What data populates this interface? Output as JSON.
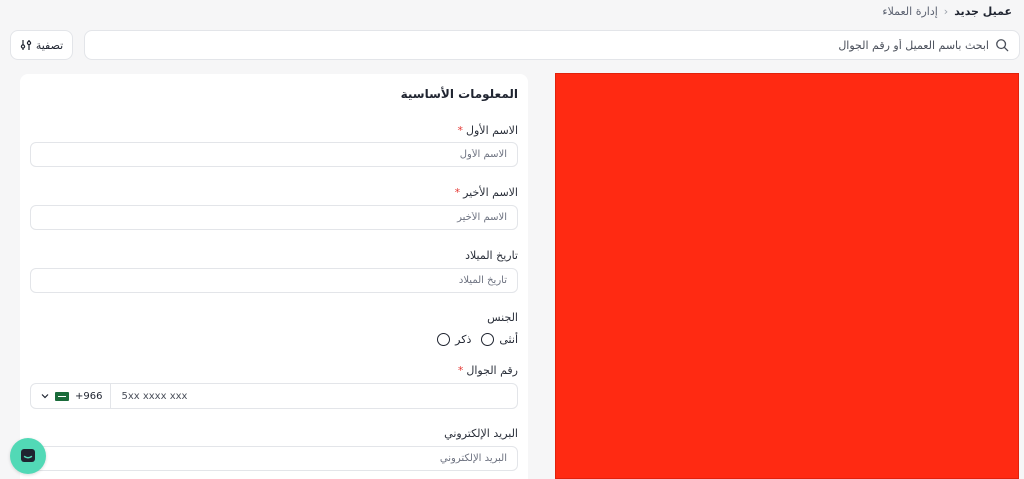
{
  "breadcrumb": {
    "parent": "إدارة العملاء",
    "current": "عميل جديد"
  },
  "search": {
    "placeholder": "ابحث باسم العميل أو رقم الجوال"
  },
  "filter": {
    "label": "تصفية"
  },
  "form": {
    "section_title": "المعلومات الأساسية",
    "first_name": {
      "label": "الاسم الأول",
      "required_mark": "*",
      "placeholder": "الاسم الأول"
    },
    "last_name": {
      "label": "الاسم الأخير",
      "required_mark": "*",
      "placeholder": "الاسم الأخير"
    },
    "birth_date": {
      "label": "تاريخ الميلاد",
      "placeholder": "تاريخ الميلاد"
    },
    "gender": {
      "label": "الجنس",
      "options": [
        {
          "label": "ذكر"
        },
        {
          "label": "أنثى"
        }
      ]
    },
    "mobile": {
      "label": "رقم الجوال",
      "required_mark": "*",
      "dial_code": "+966",
      "placeholder": "5xx xxxx xxx"
    },
    "email": {
      "label": "البريد الإلكتروني",
      "placeholder": "البريد الإلكتروني"
    }
  },
  "colors": {
    "accent_red": "#ff2a12",
    "chat_teal": "#52d9b6",
    "required": "#e53935"
  }
}
